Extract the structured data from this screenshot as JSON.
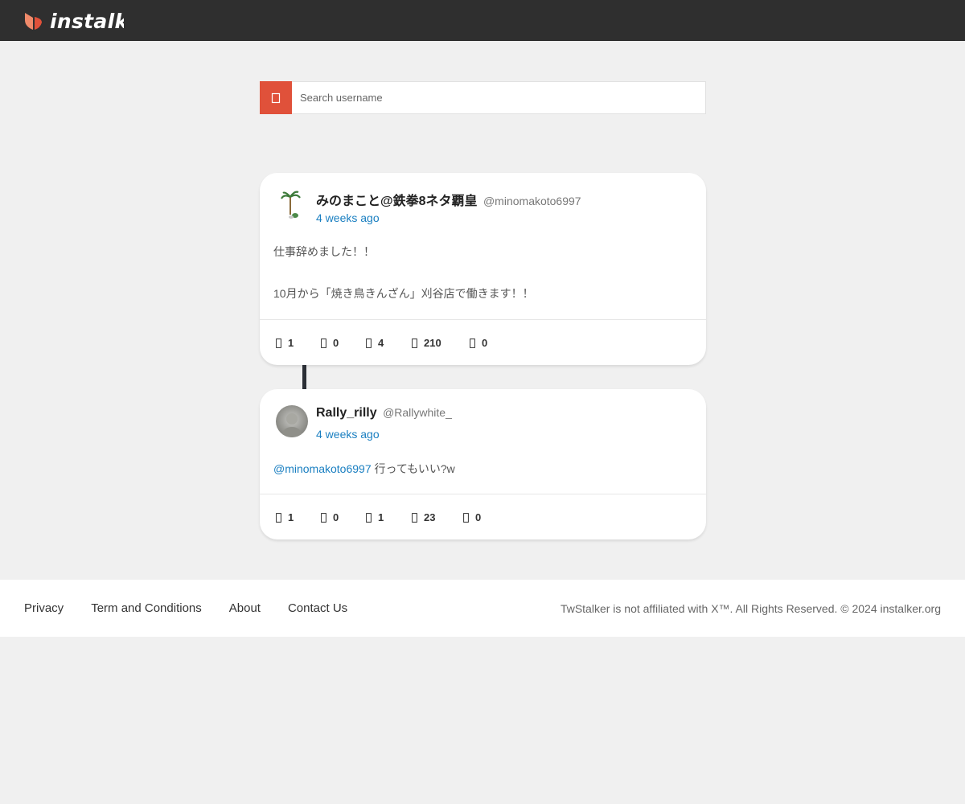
{
  "header": {
    "logo_text": "instalker"
  },
  "search": {
    "placeholder": "Search username",
    "value": ""
  },
  "tweets": [
    {
      "display_name": "みのまこと@鉄拳8ネタ覇皇",
      "handle": "@minomakoto6997",
      "time": "4 weeks ago",
      "lines": [
        "仕事辞めました！！",
        "10月から「焼き鳥きんざん」刈谷店で働きます！！"
      ],
      "stats": {
        "replies": "1",
        "retweets": "0",
        "likes": "4",
        "views": "210",
        "bookmarks": "0"
      }
    },
    {
      "display_name": "Rally_rilly",
      "handle": "@Rallywhite_",
      "time": "4 weeks ago",
      "mention": "@minomakoto6997",
      "text": " 行ってもいい?w",
      "stats": {
        "replies": "1",
        "retweets": "0",
        "likes": "1",
        "views": "23",
        "bookmarks": "0"
      }
    }
  ],
  "footer": {
    "links": [
      "Privacy",
      "Term and Conditions",
      "About",
      "Contact Us"
    ],
    "copyright": "TwStalker is not affiliated with X™. All Rights Reserved. © 2024 instalker.org"
  },
  "colors": {
    "accent": "#e0513a",
    "link": "#1a7fc1",
    "topbar": "#2f2f2f"
  }
}
